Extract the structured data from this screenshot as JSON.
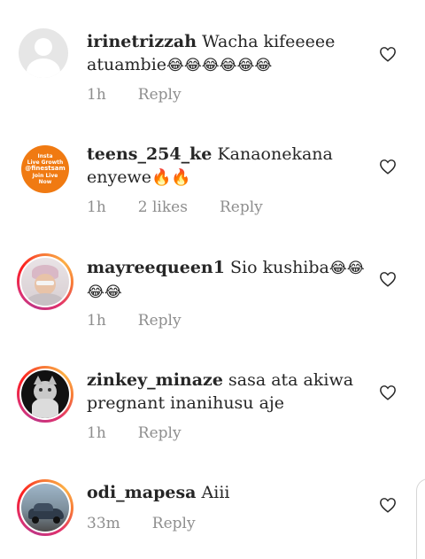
{
  "comments": [
    {
      "username": "irinetrizzah",
      "text": "Wacha kifeeeee atuambie",
      "emoji": "😂😂😂😂😂😂",
      "time": "1h",
      "likes": "",
      "reply_label": "Reply",
      "avatar": "default-avatar"
    },
    {
      "username": "teens_254_ke",
      "text": "Kanaonekana enyewe",
      "emoji": "🔥🔥",
      "time": "1h",
      "likes": "2 likes",
      "reply_label": "Reply",
      "avatar": "orange-badge-avatar",
      "avatar_text": [
        "Insta",
        "Live Growth",
        "@finestsam",
        "Join Live",
        "Now"
      ]
    },
    {
      "username": "mayreequeen1",
      "text": "Sio kushiba",
      "emoji": "😂😂😂😂",
      "time": "1h",
      "likes": "",
      "reply_label": "Reply",
      "avatar": "photo-avatar"
    },
    {
      "username": "zinkey_minaze",
      "text": "sasa ata akiwa pregnant inanihusu aje",
      "emoji": "",
      "time": "1h",
      "likes": "",
      "reply_label": "Reply",
      "avatar": "cat-avatar"
    },
    {
      "username": "odi_mapesa",
      "text": "Aiii",
      "emoji": "",
      "time": "33m",
      "likes": "",
      "reply_label": "Reply",
      "avatar": "car-avatar"
    }
  ],
  "icons": {
    "like": "heart-outline-icon"
  },
  "colors": {
    "text": "#262626",
    "meta": "#8e8e8e",
    "badge": "#f07a12"
  }
}
